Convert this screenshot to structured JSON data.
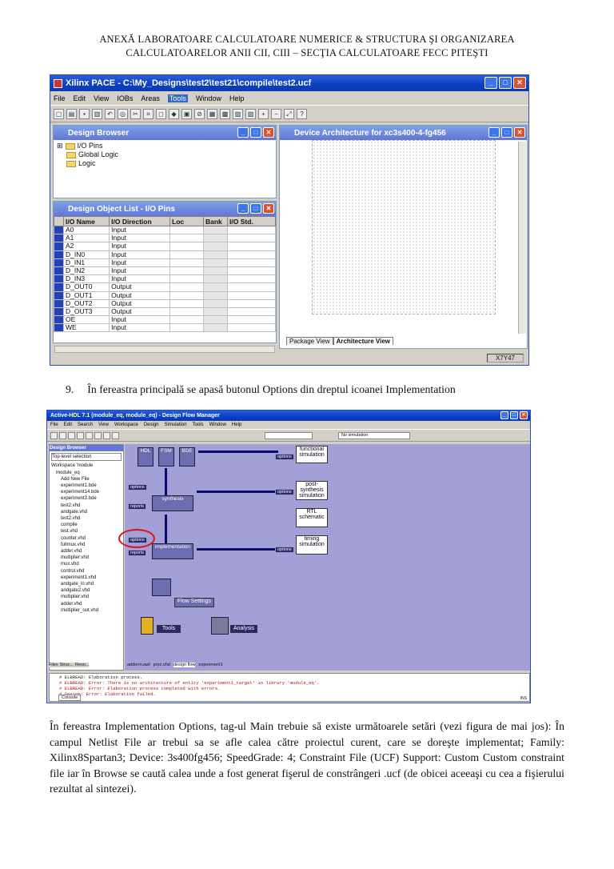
{
  "header": {
    "line1": "ANEXĂ LABORATOARE CALCULATOARE NUMERICE & STRUCTURA ŞI ORGANIZAREA",
    "line2": "CALCULATOARELOR ANII CII, CIII – SECŢIA CALCULATOARE FECC PITEŞTI"
  },
  "pace": {
    "title": "Xilinx PACE - C:\\My_Designs\\test2\\test21\\compile\\test2.ucf",
    "menus": [
      "File",
      "Edit",
      "View",
      "IOBs",
      "Areas",
      "Tools",
      "Window",
      "Help"
    ],
    "active_menu": "Tools",
    "design_browser": {
      "title": "Design Browser",
      "items": [
        "I/O Pins",
        "Global Logic",
        "Logic"
      ]
    },
    "object_list": {
      "title": "Design Object List - I/O Pins",
      "columns": [
        "I/O Name",
        "I/O Direction",
        "Loc",
        "Bank",
        "I/O Std."
      ],
      "rows": [
        [
          "A0",
          "Input"
        ],
        [
          "A1",
          "Input"
        ],
        [
          "A2",
          "Input"
        ],
        [
          "D_IN0",
          "Input"
        ],
        [
          "D_IN1",
          "Input"
        ],
        [
          "D_IN2",
          "Input"
        ],
        [
          "D_IN3",
          "Input"
        ],
        [
          "D_OUT0",
          "Output"
        ],
        [
          "D_OUT1",
          "Output"
        ],
        [
          "D_OUT2",
          "Output"
        ],
        [
          "D_OUT3",
          "Output"
        ],
        [
          "OE",
          "Input"
        ],
        [
          "WE",
          "Input"
        ]
      ]
    },
    "device": {
      "title": "Device Architecture for xc3s400-4-fg456",
      "tabs": [
        "Package View",
        "Architecture View"
      ],
      "active_tab": "Architecture View",
      "status": "X7Y47"
    }
  },
  "step9": {
    "number": "9.",
    "text": "În fereastra principală se apasă butonul Options din dreptul icoanei Implementation"
  },
  "ahdl": {
    "title": "Active-HDL 7.1 (module_eq, module_eq) - Design Flow Manager",
    "menus": [
      "File",
      "Edit",
      "Search",
      "View",
      "Workspace",
      "Design",
      "Simulation",
      "Tools",
      "Window",
      "Help"
    ],
    "toolbar_field": "No simulation",
    "design_browser": {
      "title": "Design Browser",
      "filter": "Top-level selection",
      "items": [
        "Workspace 'module",
        "module_eq",
        "Add New File",
        "experiment1.bde",
        "experiment14.bde",
        "experiment3.bde",
        "test2.vhd",
        "andgate.vhd",
        "test2.vhd",
        "compile",
        "test.vhd",
        "counter.vhd",
        "fullmux.vhd",
        "adder.vhd",
        "multiplier.vhd",
        "mux.vhd",
        "control.vhd",
        "experiment1.vhd",
        "andgate_in.vhd",
        "andgate2.vhd",
        "multiplier.vhd",
        "adder.vhd",
        "multiplier_out.vhd"
      ],
      "tabs": [
        "Files",
        "Struc...",
        "Reso..."
      ]
    },
    "flow": {
      "hdl": "HDL",
      "fsm": "FSM",
      "bde": "BDE",
      "functional": "functional simulation",
      "post_synth": "post-synthesis simulation",
      "synthesis": "synthesis",
      "rtl": "RTL schematic",
      "implementation": "implementation",
      "timing": "timing simulation",
      "flow_settings": "Flow Settings",
      "tools": "Tools",
      "analysis": "Analysis",
      "options": "options",
      "reports": "reports"
    },
    "doc_tabs": [
      "adderm.awf",
      "proc.vhd",
      "design flow",
      "experiment1"
    ],
    "console": [
      "# ELBREAD: Elaboration process.",
      "# ELBREAD: Error: There is no architecture of entity 'experiment1_target' in library 'module_eq'.",
      "# ELBREAD: Error: Elaboration process completed with errors.",
      "# Design: Error: Elaboration failed.",
      "#",
      "#"
    ],
    "console_tab": "Console",
    "status": "INS"
  },
  "paragraph": "În fereastra Implementation Options, tag-ul Main trebuie să existe următoarele setări (vezi figura de mai jos): În campul Netlist File ar trebui sa se afle calea către proiectul curent, care se doreşte implementat; Family: Xilinx8Spartan3; Device: 3s400fg456; SpeedGrade: 4; Constraint File (UCF) Support: Custom Custom constraint file iar în Browse se caută calea unde a fost generat fişerul de constrângeri .ucf (de obicei aceeaşi cu cea a fişierului rezultat al sintezei)."
}
